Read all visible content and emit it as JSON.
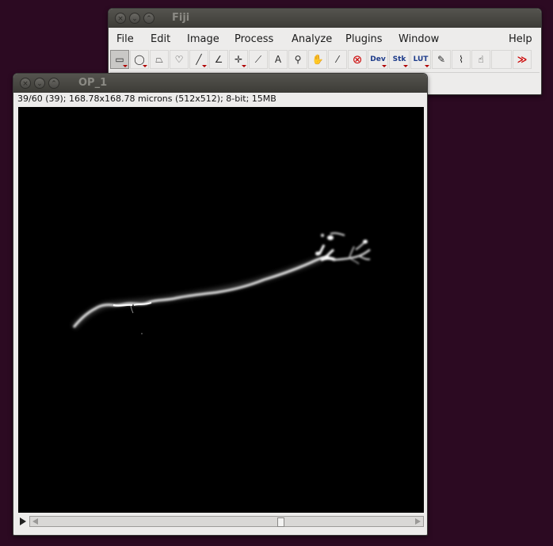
{
  "fiji_window": {
    "title": "Fiji",
    "menus": [
      "File",
      "Edit",
      "Image",
      "Process",
      "Analyze",
      "Plugins",
      "Window",
      "Help"
    ],
    "tools": [
      {
        "name": "rectangle-tool-icon",
        "glyph": "▭",
        "selected": true,
        "menu": true
      },
      {
        "name": "oval-tool-icon",
        "glyph": "◯",
        "menu": true
      },
      {
        "name": "polygon-tool-icon",
        "glyph": "⏢"
      },
      {
        "name": "freehand-tool-icon",
        "glyph": "♡"
      },
      {
        "name": "line-tool-icon",
        "glyph": "╱",
        "menu": true
      },
      {
        "name": "angle-tool-icon",
        "glyph": "∠"
      },
      {
        "name": "point-tool-icon",
        "glyph": "✛",
        "menu": true
      },
      {
        "name": "wand-tool-icon",
        "glyph": "⟋"
      },
      {
        "name": "text-tool-icon",
        "glyph": "A"
      },
      {
        "name": "magnifier-tool-icon",
        "glyph": "⚲"
      },
      {
        "name": "hand-tool-icon",
        "glyph": "✋"
      },
      {
        "name": "color-picker-tool-icon",
        "glyph": "⁄"
      },
      {
        "name": "stop-tool-icon",
        "glyph": "⊗"
      },
      {
        "name": "dev-menu-icon",
        "glyph": "Dev",
        "menu": true,
        "text": true
      },
      {
        "name": "stk-menu-icon",
        "glyph": "Stk",
        "menu": true,
        "text": true
      },
      {
        "name": "lut-menu-icon",
        "glyph": "LUT",
        "menu": true,
        "text": true
      },
      {
        "name": "pencil-tool-icon",
        "glyph": "✎"
      },
      {
        "name": "brush-tool-icon",
        "glyph": "⌇"
      },
      {
        "name": "flood-fill-tool-icon",
        "glyph": "☝"
      },
      {
        "name": "empty-tool-slot",
        "glyph": ""
      },
      {
        "name": "more-tools-icon",
        "glyph": "≫"
      }
    ]
  },
  "image_window": {
    "title": "OP_1",
    "info": "39/60 (39); 168.78x168.78 microns (512x512); 8-bit; 15MB",
    "slice_current": 39,
    "slice_total": 60
  },
  "colors": {
    "desktop": "#2c0a22",
    "image_background": "#000000",
    "stop_icon": "#cc0000",
    "more_tools": "#cc0000"
  }
}
